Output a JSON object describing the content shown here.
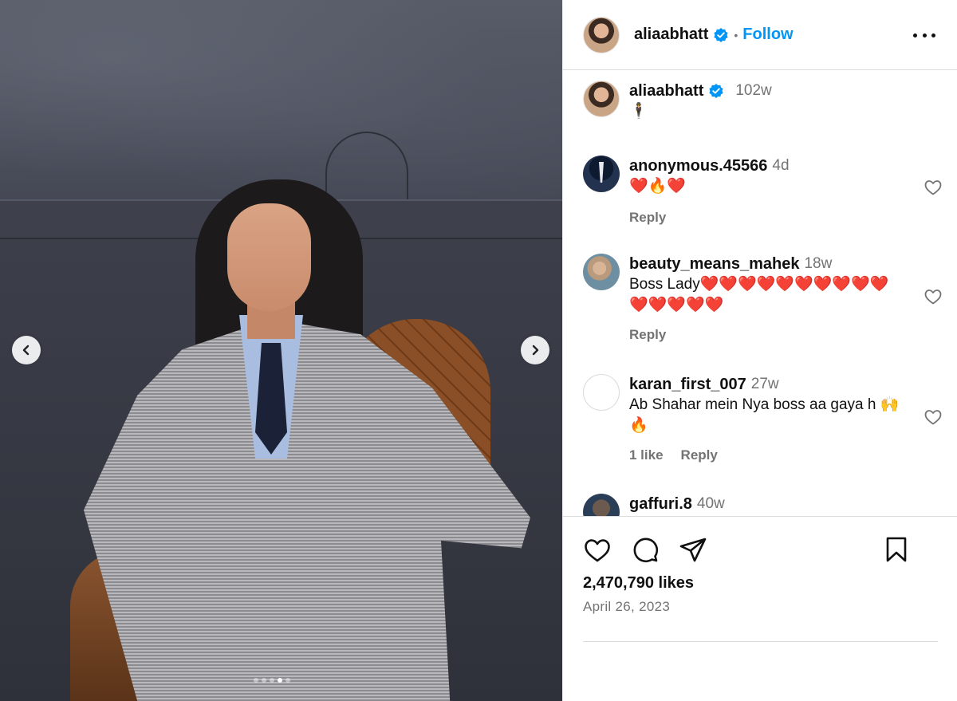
{
  "post": {
    "username": "aliaabhatt",
    "follow_label": "Follow",
    "separator": "•",
    "caption": {
      "username": "aliaabhatt",
      "time": "102w",
      "text": "🕴"
    }
  },
  "carousel": {
    "total_slides": 5,
    "active_slide": 4
  },
  "comments": [
    {
      "username": "anonymous.45566",
      "time": "4d",
      "text": "❤️🔥❤️",
      "reply_label": "Reply",
      "likes_label": ""
    },
    {
      "username": "beauty_means_mahek",
      "time": "18w",
      "text": "Boss Lady❤️❤️❤️❤️❤️❤️❤️❤️❤️❤️❤️❤️❤️❤️❤️",
      "reply_label": "Reply",
      "likes_label": ""
    },
    {
      "username": "karan_first_007",
      "time": "27w",
      "text": "Ab Shahar mein Nya boss aa gaya h 🙌🔥",
      "reply_label": "Reply",
      "likes_label": "1 like"
    },
    {
      "username": "gaffuri.8",
      "time": "40w",
      "text": "",
      "reply_label": "",
      "likes_label": ""
    }
  ],
  "stats": {
    "likes": "2,470,790 likes",
    "date": "April 26, 2023"
  },
  "colors": {
    "accent": "#0095f6",
    "verified": "#0095f6",
    "muted": "#737373",
    "border": "#dbdbdb"
  },
  "icons": [
    "chevron-left-icon",
    "chevron-right-icon",
    "verified-icon",
    "more-icon",
    "heart-icon",
    "comment-icon",
    "share-icon",
    "bookmark-icon"
  ]
}
